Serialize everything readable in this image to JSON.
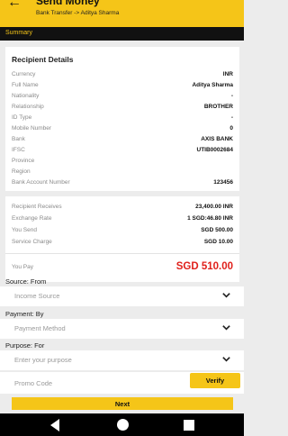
{
  "header": {
    "back_icon": "back-arrow-icon",
    "title": "Send Money",
    "subtitle": "Bank Transfer -> Aditya Sharma"
  },
  "summary_label": "Summary",
  "recipient": {
    "section_title": "Recipient Details",
    "rows": [
      {
        "label": "Currency",
        "value": "INR"
      },
      {
        "label": "Full Name",
        "value": "Aditya Sharma"
      },
      {
        "label": "Nationality",
        "value": "-"
      },
      {
        "label": "Relationship",
        "value": "BROTHER"
      },
      {
        "label": "ID Type",
        "value": "-"
      },
      {
        "label": "Mobile Number",
        "value": "0"
      },
      {
        "label": "Bank",
        "value": "AXIS BANK"
      },
      {
        "label": "IFSC",
        "value": "UTIB0002684"
      },
      {
        "label": "Province",
        "value": ""
      },
      {
        "label": "Region",
        "value": ""
      },
      {
        "label": "Bank Account Number",
        "value": "123456"
      }
    ]
  },
  "amounts": {
    "rows": [
      {
        "label": "Recipient Receives",
        "value": "23,400.00 INR"
      },
      {
        "label": "Exchange Rate",
        "value": "1 SGD:46.80 INR"
      },
      {
        "label": "You Send",
        "value": "SGD 500.00"
      },
      {
        "label": "Service Charge",
        "value": "SGD 10.00"
      }
    ],
    "pay_label": "You Pay",
    "pay_value": "SGD 510.00"
  },
  "form": {
    "source_label": "Source: From",
    "source_placeholder": "Income Source",
    "payment_label": "Payment: By",
    "payment_placeholder": "Payment Method",
    "purpose_label": "Purpose: For",
    "purpose_placeholder": "Enter your purpose",
    "promo_placeholder": "Promo Code",
    "verify_label": "Verify",
    "next_label": "Next"
  },
  "colors": {
    "accent": "#f5c518",
    "header_bar": "#111111",
    "pay_amount": "#e0201b"
  }
}
